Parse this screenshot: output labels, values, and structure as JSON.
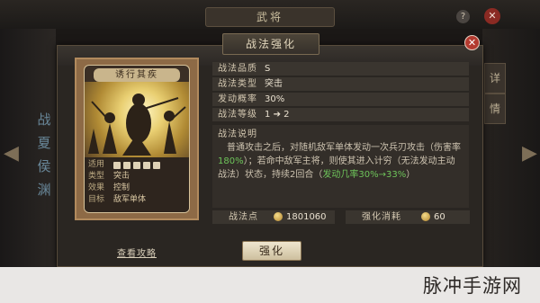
{
  "background": {
    "top_title": "武将",
    "help_icon": "?",
    "close_icon": "✕",
    "left_side_chars": [
      "战",
      "夏",
      "侯",
      "渊"
    ],
    "right_tabs": [
      "详",
      "情"
    ]
  },
  "dialog": {
    "title": "战法强化",
    "close_icon": "close-icon"
  },
  "card": {
    "name": "诱行其疾",
    "info": [
      {
        "k": "适用",
        "v": ""
      },
      {
        "k": "类型",
        "v": "突击"
      },
      {
        "k": "效果",
        "v": "控制"
      },
      {
        "k": "目标",
        "v": "敌军单体"
      }
    ],
    "troop_icons": [
      "cavalry-icon",
      "shield-icon",
      "bow-icon",
      "spear-icon",
      "siege-icon"
    ]
  },
  "attributes": [
    {
      "key": "战法品质",
      "value": "S"
    },
    {
      "key": "战法类型",
      "value": "突击"
    },
    {
      "key": "发动概率",
      "value": "30%"
    },
    {
      "key": "战法等级",
      "value_from": "1",
      "value_to": "2"
    }
  ],
  "description": {
    "label": "战法说明",
    "text_part1": "普通攻击之后，对随机敌军单体发动一次兵刃攻击（伤害率",
    "text_green1": "180%",
    "text_part2": "）；若命中敌军主将，则使其进入计穷（无法发动主动战法）状态，持续2回合（",
    "text_green2": "发动几率30%→33%",
    "text_part3": "）"
  },
  "resources": {
    "points_label": "战法点",
    "points_value": "1801060",
    "cost_label": "强化消耗",
    "cost_value": "60"
  },
  "footer": {
    "guide_link": "查看攻略",
    "upgrade_button": "强化"
  },
  "watermark": "脉冲手游网"
}
